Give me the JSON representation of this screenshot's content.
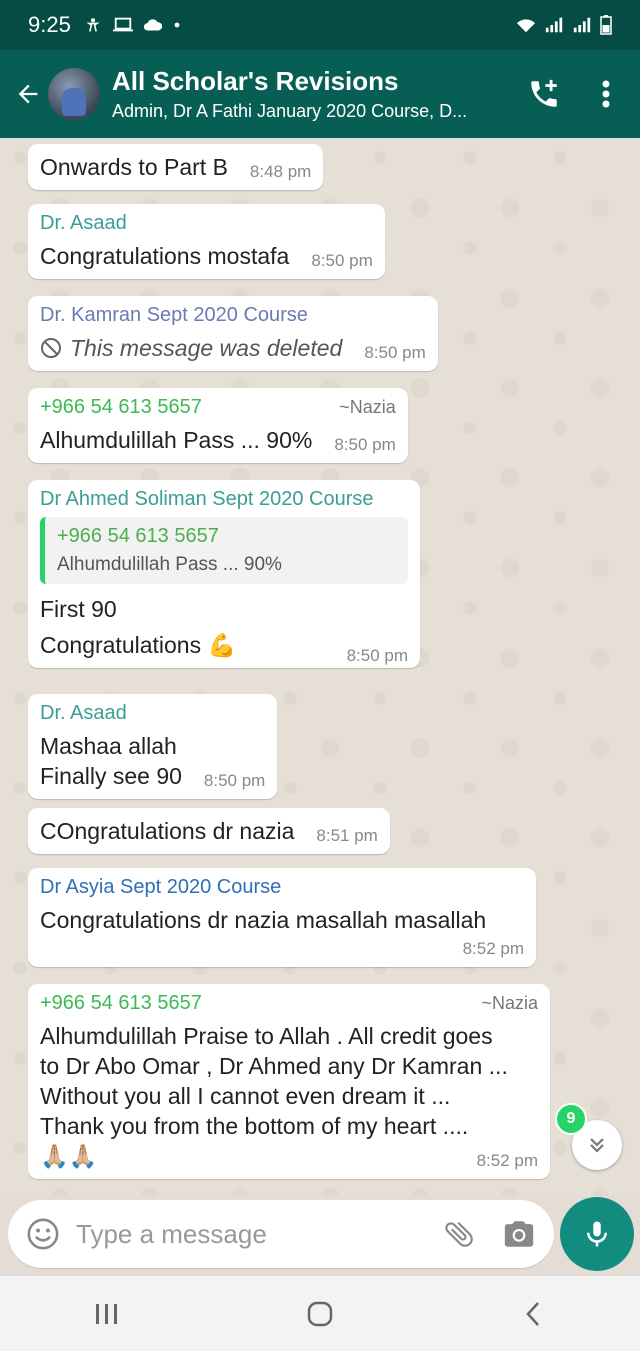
{
  "status_bar": {
    "time": "9:25"
  },
  "header": {
    "title": "All Scholar's Revisions",
    "subtitle": "Admin, Dr A Fathi January 2020 Course, D..."
  },
  "messages": [
    {
      "text": "Onwards to Part B",
      "time": "8:48 pm"
    },
    {
      "sender": "Dr. Asaad",
      "sender_color": "#3a9e94",
      "text": "Congratulations mostafa",
      "time": "8:50 pm"
    },
    {
      "sender": "Dr. Kamran Sept 2020 Course",
      "sender_color": "#6a7bb3",
      "text": "This message was deleted",
      "time": "8:50 pm"
    },
    {
      "sender": "+966 54 613 5657",
      "sender_color": "#3cba54",
      "pushname": "~Nazia",
      "text": "Alhumdulillah Pass ... 90%",
      "time": "8:50 pm"
    },
    {
      "sender": "Dr Ahmed Soliman Sept 2020 Course",
      "sender_color": "#3a9e94",
      "quote": {
        "name": "+966 54 613 5657",
        "text": "Alhumdulillah Pass ... 90%"
      },
      "line1": "First 90",
      "line2": "Congratulations 💪",
      "time": "8:50 pm"
    },
    {
      "sender": "Dr. Asaad",
      "sender_color": "#3a9e94",
      "line1": "Mashaa allah",
      "line2": "Finally see 90",
      "time": "8:50 pm"
    },
    {
      "text": "COngratulations dr nazia",
      "time": "8:51 pm"
    },
    {
      "sender": "Dr Asyia Sept 2020 Course",
      "sender_color": "#2f6fb5",
      "text": "Congratulations dr nazia masallah masallah",
      "time": "8:52 pm"
    },
    {
      "sender": "+966 54 613 5657",
      "sender_color": "#3cba54",
      "pushname": "~Nazia",
      "line1": "Alhumdulillah Praise to Allah  . All credit goes",
      "line2": "to Dr Abo Omar , Dr Ahmed any Dr Kamran ...",
      "line3": "Without you all I cannot even dream it ...",
      "line4": "Thank you from the bottom of my heart ....",
      "line5": "🙏🏼🙏🏼",
      "time": "8:52 pm"
    }
  ],
  "scroll": {
    "unread_count": "9"
  },
  "composer": {
    "placeholder": "Type a message"
  },
  "colors": {
    "header": "#075e54",
    "accent": "#128c7e",
    "badge": "#25d366"
  }
}
